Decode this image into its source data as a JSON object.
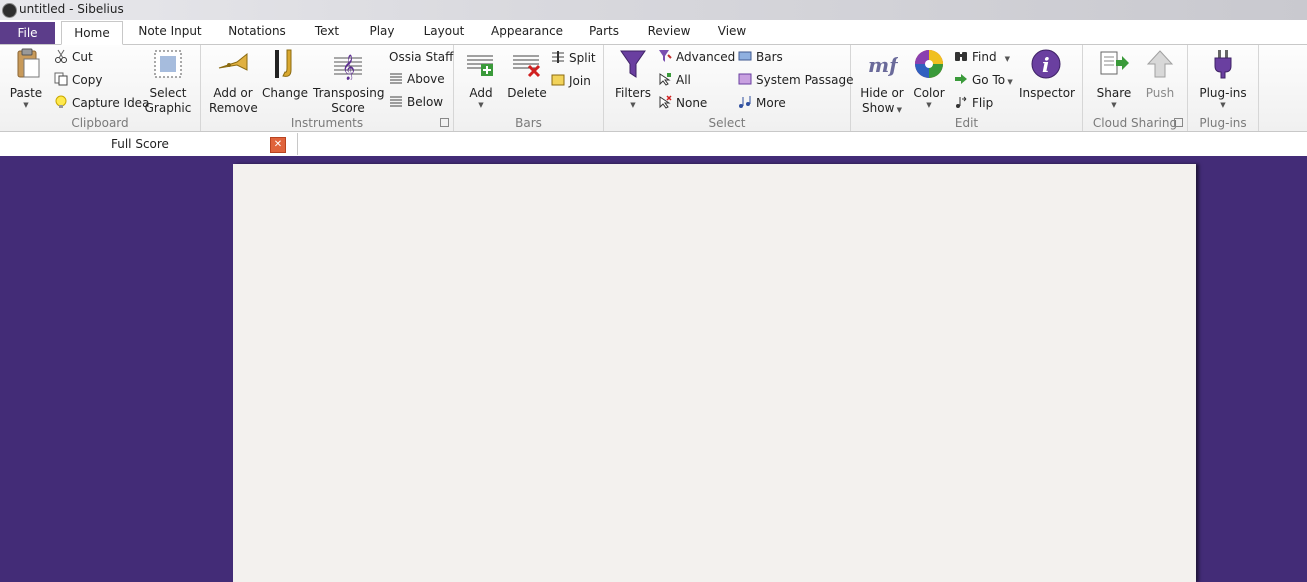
{
  "window": {
    "title": "untitled - Sibelius"
  },
  "menu_tabs": [
    "File",
    "Home",
    "Note Input",
    "Notations",
    "Text",
    "Play",
    "Layout",
    "Appearance",
    "Parts",
    "Review",
    "View"
  ],
  "groups": {
    "clipboard": {
      "label": "Clipboard",
      "paste": "Paste",
      "cut": "Cut",
      "copy": "Copy",
      "capture_idea": "Capture Idea",
      "select_graphic_1": "Select",
      "select_graphic_2": "Graphic"
    },
    "instruments": {
      "label": "Instruments",
      "add_remove_1": "Add or",
      "add_remove_2": "Remove",
      "change": "Change",
      "transposing_1": "Transposing",
      "transposing_2": "Score",
      "ossia_staff": "Ossia Staff",
      "above": "Above",
      "below": "Below"
    },
    "bars": {
      "label": "Bars",
      "add": "Add",
      "delete": "Delete",
      "split": "Split",
      "join": "Join"
    },
    "select": {
      "label": "Select",
      "filters": "Filters",
      "advanced": "Advanced",
      "all": "All",
      "none": "None",
      "bars": "Bars",
      "system_passage": "System Passage",
      "more": "More"
    },
    "edit": {
      "label": "Edit",
      "hide_show_1": "Hide or",
      "hide_show_2": "Show",
      "color": "Color",
      "find": "Find",
      "go_to": "Go To",
      "flip": "Flip",
      "inspector": "Inspector"
    },
    "cloud": {
      "label": "Cloud Sharing",
      "share": "Share",
      "push": "Push"
    },
    "plugins": {
      "label": "Plug-ins",
      "plugins": "Plug-ins"
    }
  },
  "document_tab": {
    "label": "Full Score"
  }
}
